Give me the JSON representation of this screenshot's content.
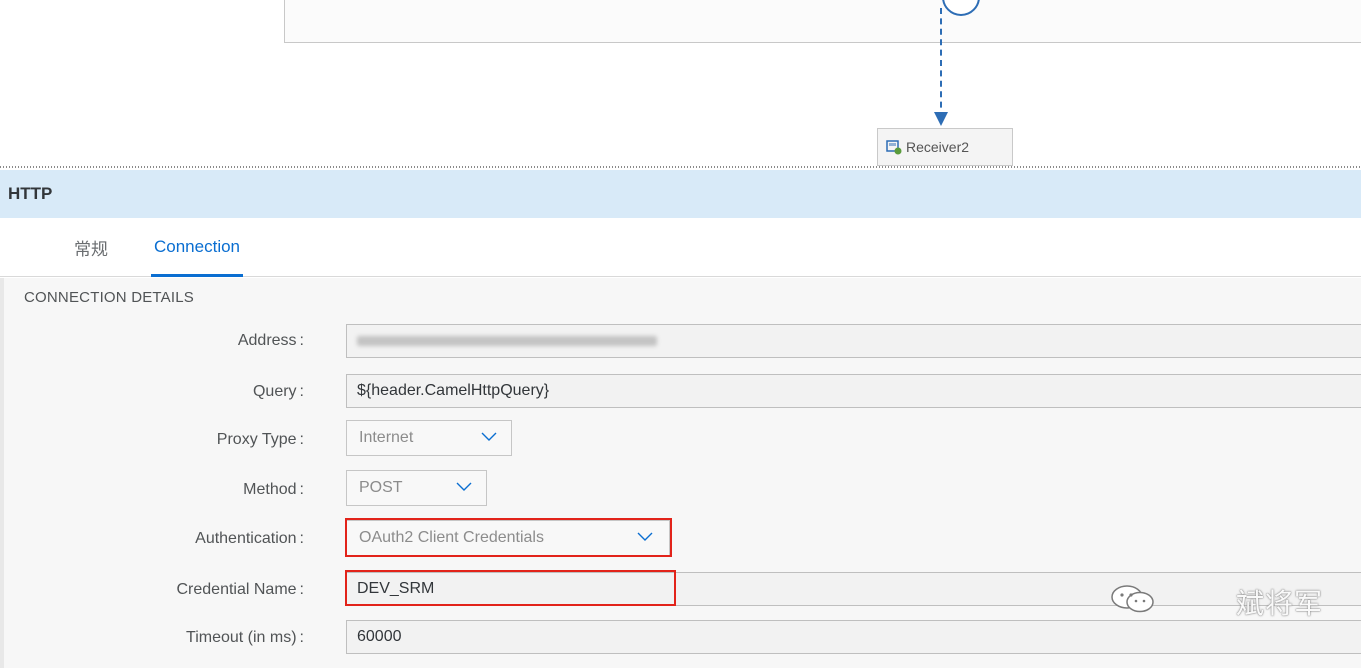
{
  "canvas": {
    "receiver_label": "Receiver2"
  },
  "panel": {
    "title": "HTTP",
    "tabs": [
      {
        "label": "常规",
        "active": false
      },
      {
        "label": "Connection",
        "active": true
      }
    ],
    "section_title": "CONNECTION DETAILS",
    "fields": {
      "address": {
        "label": "Address",
        "value": ""
      },
      "query": {
        "label": "Query",
        "value": "${header.CamelHttpQuery}"
      },
      "proxy_type": {
        "label": "Proxy Type",
        "value": "Internet"
      },
      "method": {
        "label": "Method",
        "value": "POST"
      },
      "authentication": {
        "label": "Authentication",
        "value": "OAuth2 Client Credentials"
      },
      "credential_name": {
        "label": "Credential Name",
        "value": "DEV_SRM"
      },
      "timeout": {
        "label": "Timeout (in ms)",
        "value": "60000"
      }
    },
    "colon": ":"
  },
  "watermark": {
    "text": "斌将军",
    "icon": "wechat-icon"
  },
  "colors": {
    "accent": "#0a6ed1",
    "header_bg": "#d8eaf8",
    "highlight": "#e2231a",
    "flow_line": "#2d6db5"
  }
}
